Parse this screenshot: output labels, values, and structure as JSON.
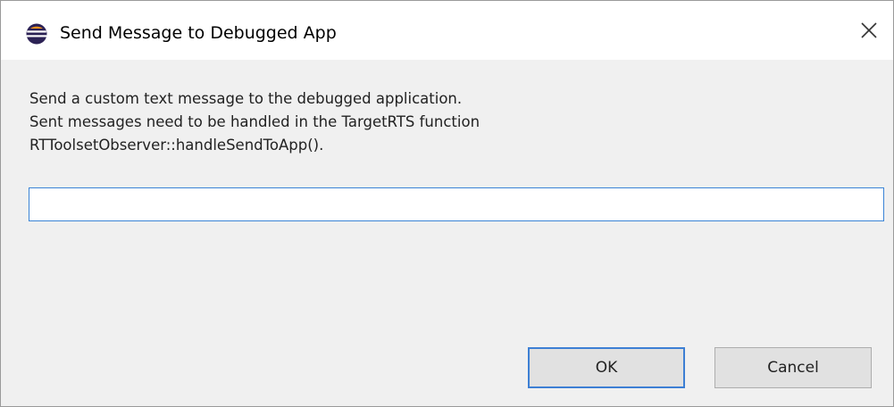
{
  "window": {
    "title": "Send Message to Debugged App",
    "app_icon": "eclipse-icon",
    "close_icon": "close-icon"
  },
  "message": {
    "lines": [
      "Send a custom text message to the debugged application.",
      "Sent messages need to be handled in the TargetRTS function",
      "RTToolsetObserver::handleSendToApp()."
    ]
  },
  "input": {
    "value": "",
    "placeholder": ""
  },
  "buttons": {
    "ok_label": "OK",
    "cancel_label": "Cancel"
  },
  "colors": {
    "focus_border": "#3d7fd4",
    "dialog_background": "#f0f0f0",
    "button_background": "#e1e1e1",
    "icon_purple": "#2c2255",
    "icon_orange": "#f7941e"
  }
}
